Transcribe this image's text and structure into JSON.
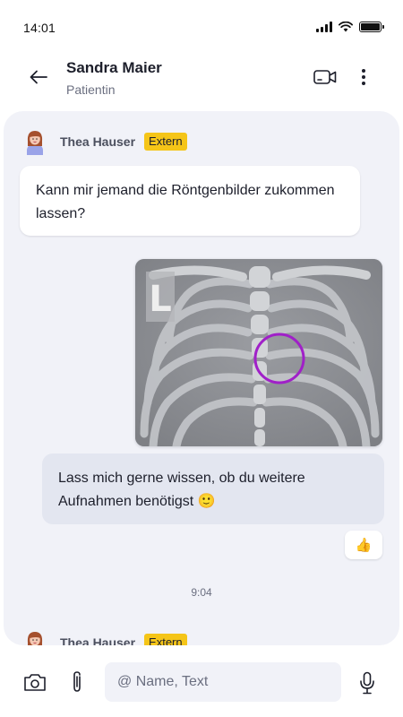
{
  "status": {
    "time": "14:01",
    "icons": [
      "signal-icon",
      "wifi-icon",
      "battery-icon"
    ]
  },
  "header": {
    "title": "Sandra Maier",
    "subtitle": "Patientin",
    "icons": [
      "back-arrow-icon",
      "video-call-icon",
      "more-vertical-icon"
    ]
  },
  "messages": {
    "first_sender": {
      "name": "Thea Hauser",
      "badge": "Extern"
    },
    "incoming_text": "Kann mir jemand die Röntgenbilder zukommen lassen?",
    "image": {
      "overlay_letter": "L",
      "annotation_color": "#a020c8"
    },
    "outgoing_text": "Lass mich gerne wissen, ob du weitere Aufnahmen benötigst 🙂",
    "reaction": "👍",
    "timestamp": "9:04",
    "second_sender": {
      "name": "Thea Hauser",
      "badge": "Extern"
    }
  },
  "composer": {
    "placeholder": "@ Name, Text",
    "value": "",
    "icons": [
      "camera-icon",
      "paperclip-icon",
      "microphone-icon"
    ]
  },
  "colors": {
    "accent_badge": "#f5c518",
    "chat_background": "#f1f2f8",
    "outgoing_bubble": "#e3e6f0"
  }
}
